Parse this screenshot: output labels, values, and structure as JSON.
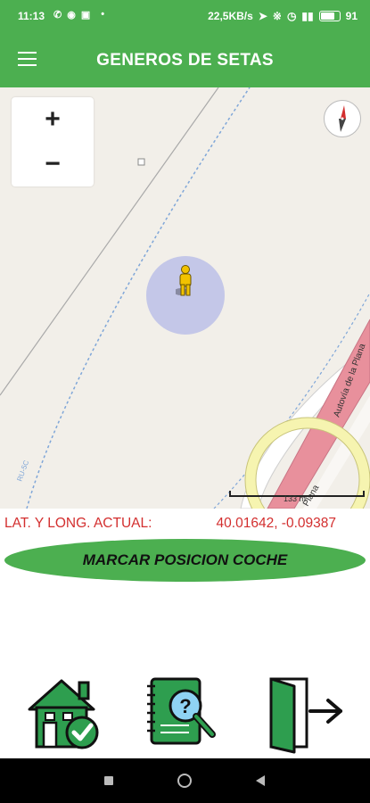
{
  "status_bar": {
    "time": "11:13",
    "network_speed": "22,5KB/s",
    "battery": "91",
    "battery_level": 0.91,
    "notification_icons": [
      "whatsapp-icon",
      "messenger-icon",
      "laptop-icon",
      "dot-icon"
    ],
    "status_icons": [
      "bluetooth-icon",
      "location-icon",
      "alarm-icon",
      "signal-icon"
    ]
  },
  "app_bar": {
    "title": "GENEROS DE SETAS",
    "menu_icon": "hamburger-menu-icon"
  },
  "map": {
    "zoom_in_label": "+",
    "zoom_out_label": "−",
    "compass_icon": "compass-icon",
    "my_location_icon": "person-icon",
    "road_label_1": "Autovía de la Plana",
    "road_label_2": "Plana",
    "path_label": "RU-5C",
    "scale_label": "133 m"
  },
  "coordinates": {
    "label": "LAT. Y LONG. ACTUAL:",
    "value": "40.01642, -0.09387"
  },
  "park_button": {
    "label": "MARCAR POSICION COCHE"
  },
  "bottom_actions": [
    {
      "name": "home-check-button",
      "icon": "house-check-icon"
    },
    {
      "name": "search-guide-button",
      "icon": "notebook-magnifier-icon"
    },
    {
      "name": "exit-button",
      "icon": "exit-door-icon"
    }
  ],
  "colors": {
    "primary": "#4caf50",
    "coords_text": "#d32f2f",
    "motorway": "#e8909c",
    "roundabout": "#f6f4b0"
  }
}
